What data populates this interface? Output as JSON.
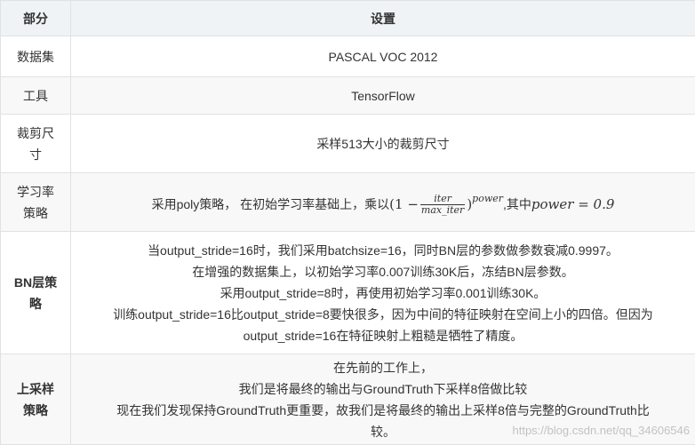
{
  "table": {
    "headers": [
      "部分",
      "设置"
    ],
    "rows": {
      "dataset": {
        "key": "数据集",
        "value": "PASCAL VOC 2012"
      },
      "tool": {
        "key": "工具",
        "value": "TensorFlow"
      },
      "crop": {
        "key": "裁剪尺寸",
        "key_lines": [
          "裁剪尺",
          "寸"
        ],
        "value": "采样513大小的裁剪尺寸"
      },
      "lr": {
        "key": "学习率策略",
        "key_lines": [
          "学习率",
          "策略"
        ],
        "text_before": "采用poly策略， 在初始学习率基础上，乘以",
        "formula": {
          "open": "(1 −",
          "numerator": "iter",
          "denominator": "max_iter",
          "close": ")",
          "exponent": "power"
        },
        "text_middle": ",其中",
        "formula2": "power = 0.9"
      },
      "bn": {
        "key": "BN层策略",
        "key_lines": [
          "BN层策",
          "略"
        ],
        "lines": [
          "当output_stride=16时，我们采用batchsize=16，同时BN层的参数做参数衰减0.9997。",
          "在增强的数据集上，以初始学习率0.007训练30K后，冻结BN层参数。",
          "采用output_stride=8时，再使用初始学习率0.001训练30K。",
          "训练output_stride=16比output_stride=8要快很多，因为中间的特征映射在空间上小的四倍。但因为",
          "output_stride=16在特征映射上粗糙是牺牲了精度。"
        ]
      },
      "upsample": {
        "key": "上采样策略",
        "key_lines": [
          "上采样",
          "策略"
        ],
        "lines": [
          "在先前的工作上，",
          "我们是将最终的输出与GroundTruth下采样8倍做比较",
          "现在我们发现保持GroundTruth更重要，故我们是将最终的输出上采样8倍与完整的GroundTruth比",
          "较。"
        ]
      }
    }
  },
  "watermark": "https://blog.csdn.net/qq_34606546"
}
